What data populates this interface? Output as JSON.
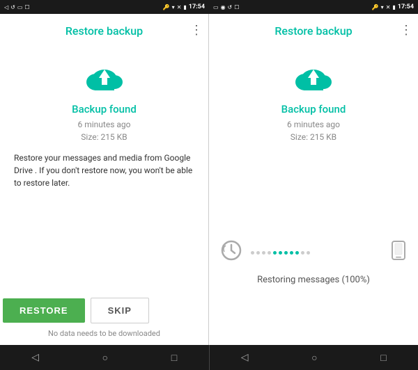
{
  "screens": [
    {
      "id": "screen-left",
      "title": "Restore backup",
      "backup_status": "Backup found",
      "backup_time": "6 minutes ago",
      "backup_size": "Size: 215 KB",
      "description": "Restore your messages and media from Google Drive . If you don't restore now, you won't be able to restore later.",
      "btn_restore": "RESTORE",
      "btn_skip": "SKIP",
      "no_download": "No data needs to be downloaded"
    },
    {
      "id": "screen-right",
      "title": "Restore backup",
      "backup_status": "Backup found",
      "backup_time": "6 minutes ago",
      "backup_size": "Size: 215 KB",
      "restoring_text": "Restoring messages (100%)",
      "dots": [
        "gray",
        "gray",
        "gray",
        "gray",
        "green",
        "green",
        "green",
        "green",
        "green",
        "gray",
        "gray"
      ]
    }
  ],
  "status_bar": {
    "time": "17:54"
  },
  "nav_bar": {
    "back": "◁",
    "home": "○",
    "recent": "□"
  }
}
